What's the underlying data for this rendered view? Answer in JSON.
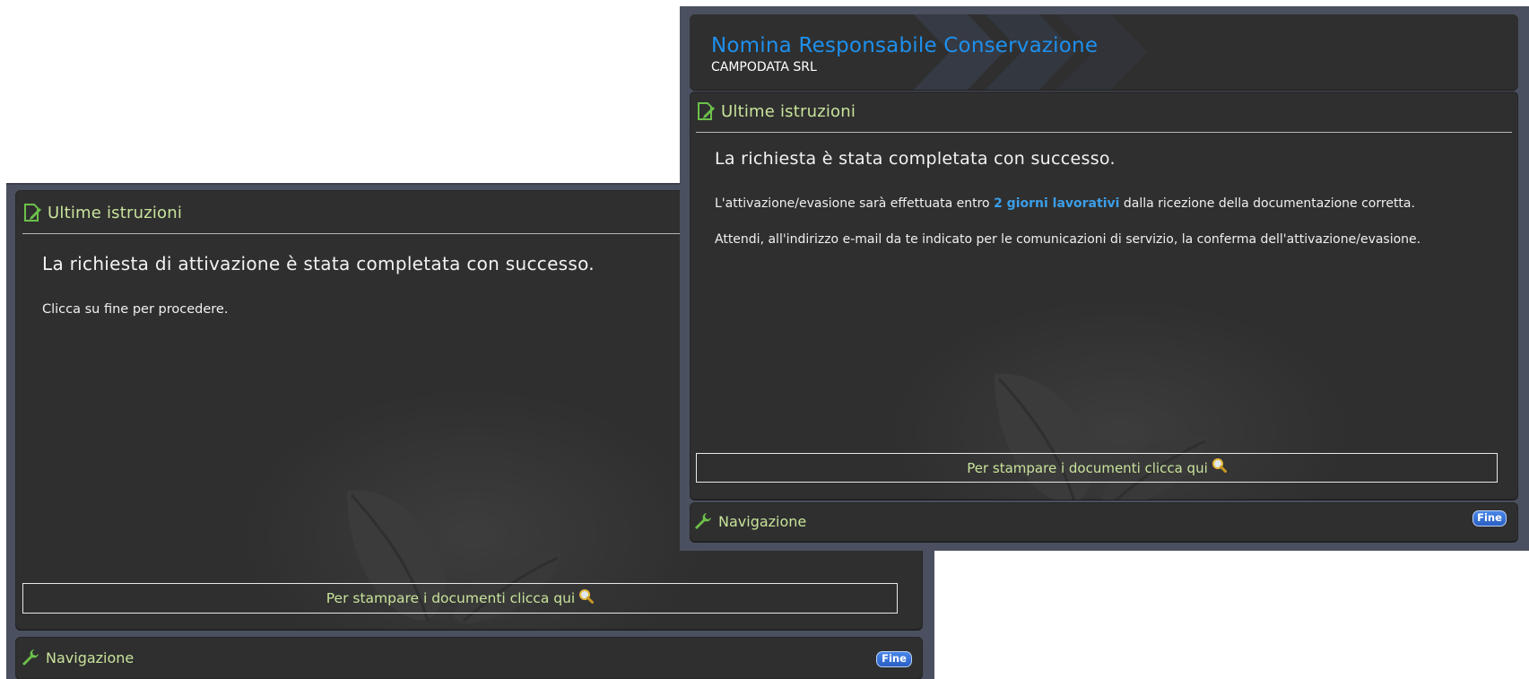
{
  "back_window": {
    "section_title": "Ultime istruzioni",
    "message_title": "La richiesta di attivazione è stata completata con successo.",
    "message_text": "Clicca su fine per procedere.",
    "print_label": "Per stampare i documenti clicca qui",
    "nav_title": "Navigazione",
    "fine_label": "Fine"
  },
  "front_window": {
    "header_title": "Nomina Responsabile Conservazione",
    "header_subtitle": "CAMPODATA SRL",
    "section_title": "Ultime istruzioni",
    "message_title": "La richiesta è stata completata con successo.",
    "message_line1_prefix": "L'attivazione/evasione sarà effettuata entro ",
    "message_line1_highlight": "2 giorni lavorativi",
    "message_line1_suffix": " dalla ricezione della documentazione corretta.",
    "message_line2": "Attendi, all'indirizzo e-mail da te indicato per le comunicazioni di servizio, la conferma dell'attivazione/evasione.",
    "print_label": "Per stampare i documenti clicca qui",
    "nav_title": "Navigazione",
    "fine_label": "Fine"
  },
  "icons": {
    "instructions": "edit-document-icon",
    "print": "magnifier-icon",
    "navigation": "wrench-icon"
  },
  "colors": {
    "frame": "#4b5060",
    "panel": "#2f2f2f",
    "section_title": "#c8e39b",
    "header_title": "#1e90ee",
    "highlight": "#3b9ee8",
    "button": "#2a5fc4"
  }
}
